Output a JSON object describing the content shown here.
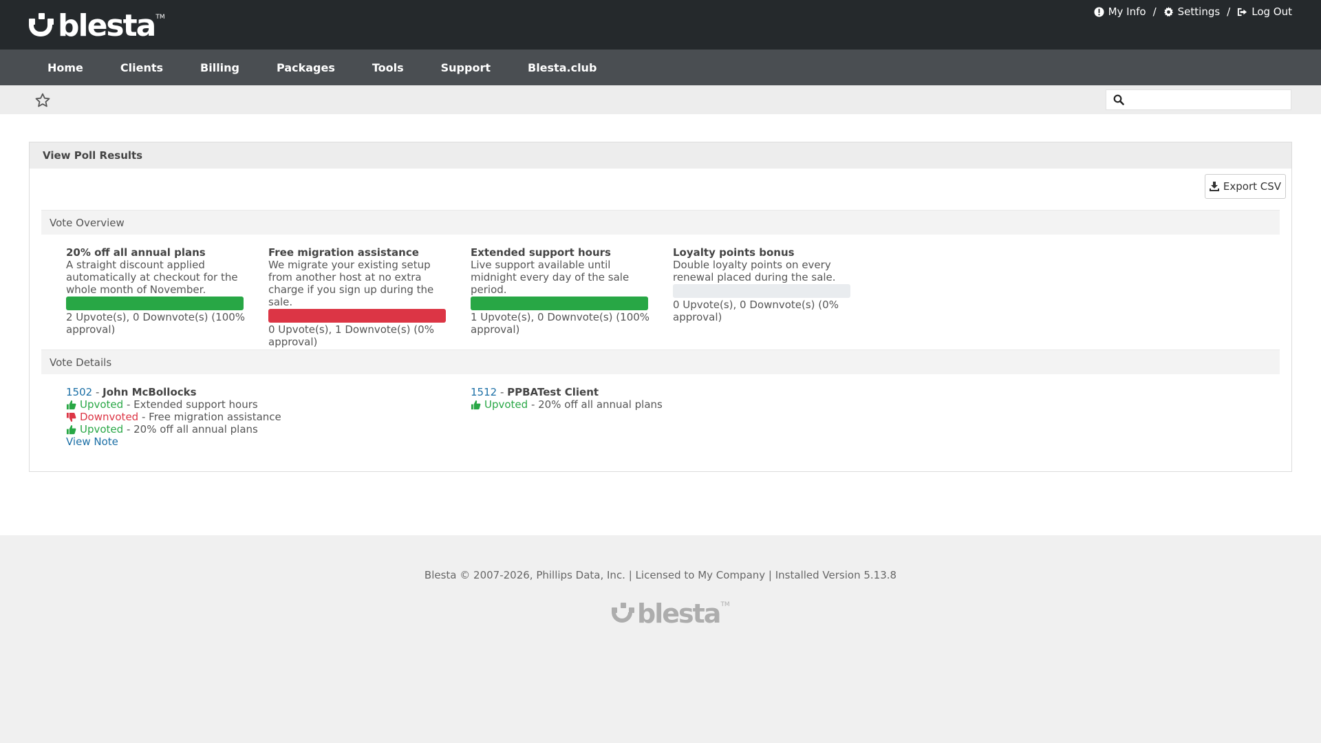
{
  "header": {
    "logo_text": "blesta",
    "logo_tm": "TM",
    "links": {
      "my_info": "My Info",
      "settings": "Settings",
      "log_out": "Log Out",
      "separator": "/"
    }
  },
  "nav": {
    "items": [
      "Home",
      "Clients",
      "Billing",
      "Packages",
      "Tools",
      "Support",
      "Blesta.club"
    ]
  },
  "search": {
    "placeholder": "",
    "value": ""
  },
  "panel": {
    "title": "View Poll Results",
    "export_label": "Export CSV",
    "overview_label": "Vote Overview",
    "details_label": "Vote Details"
  },
  "options": [
    {
      "title": "20% off all annual plans",
      "description": "A straight discount applied automatically at checkout for the whole month of November.",
      "approval": 1.0,
      "bar_color": "#28a745",
      "count_text": "2 Upvote(s), 0 Downvote(s) (100% approval)"
    },
    {
      "title": "Free migration assistance",
      "description": "We migrate your existing setup from another host at no extra charge if you sign up during the sale.",
      "approval": 1.0,
      "bar_color": "#dc3545",
      "count_text": "0 Upvote(s), 1 Downvote(s) (0% approval)"
    },
    {
      "title": "Extended support hours",
      "description": "Live support available until midnight every day of the sale period.",
      "approval": 1.0,
      "bar_color": "#28a745",
      "count_text": "1 Upvote(s), 0 Downvote(s) (100% approval)"
    },
    {
      "title": "Loyalty points bonus",
      "description": "Double loyalty points on every renewal placed during the sale.",
      "approval": 0,
      "bar_color": "#e9ecef",
      "count_text": "0 Upvote(s), 0 Downvote(s) (0% approval)"
    }
  ],
  "clients": [
    {
      "id": "1502",
      "dash": " - ",
      "name": "John McBollocks",
      "votes": [
        {
          "status": "Upvoted",
          "type": "up",
          "option": " - Extended support hours"
        },
        {
          "status": "Downvoted",
          "type": "down",
          "option": " - Free migration assistance"
        },
        {
          "status": "Upvoted",
          "type": "up",
          "option": " - 20% off all annual plans"
        }
      ],
      "note_link": "View Note"
    },
    {
      "id": "1512",
      "dash": " - ",
      "name": "PPBATest Client",
      "votes": [
        {
          "status": "Upvoted",
          "type": "up",
          "option": " - 20% off all annual plans"
        }
      ],
      "note_link": ""
    }
  ],
  "footer": {
    "text": "Blesta © 2007-2026, Phillips Data, Inc. | Licensed to My Company | Installed Version 5.13.8",
    "logo_text": "blesta",
    "logo_tm": "TM"
  },
  "colors": {
    "header_bg": "#25292c",
    "nav_bg": "#4a4e52",
    "link": "#1a6ea5",
    "upvote": "#28a745",
    "downvote": "#dc3545"
  }
}
